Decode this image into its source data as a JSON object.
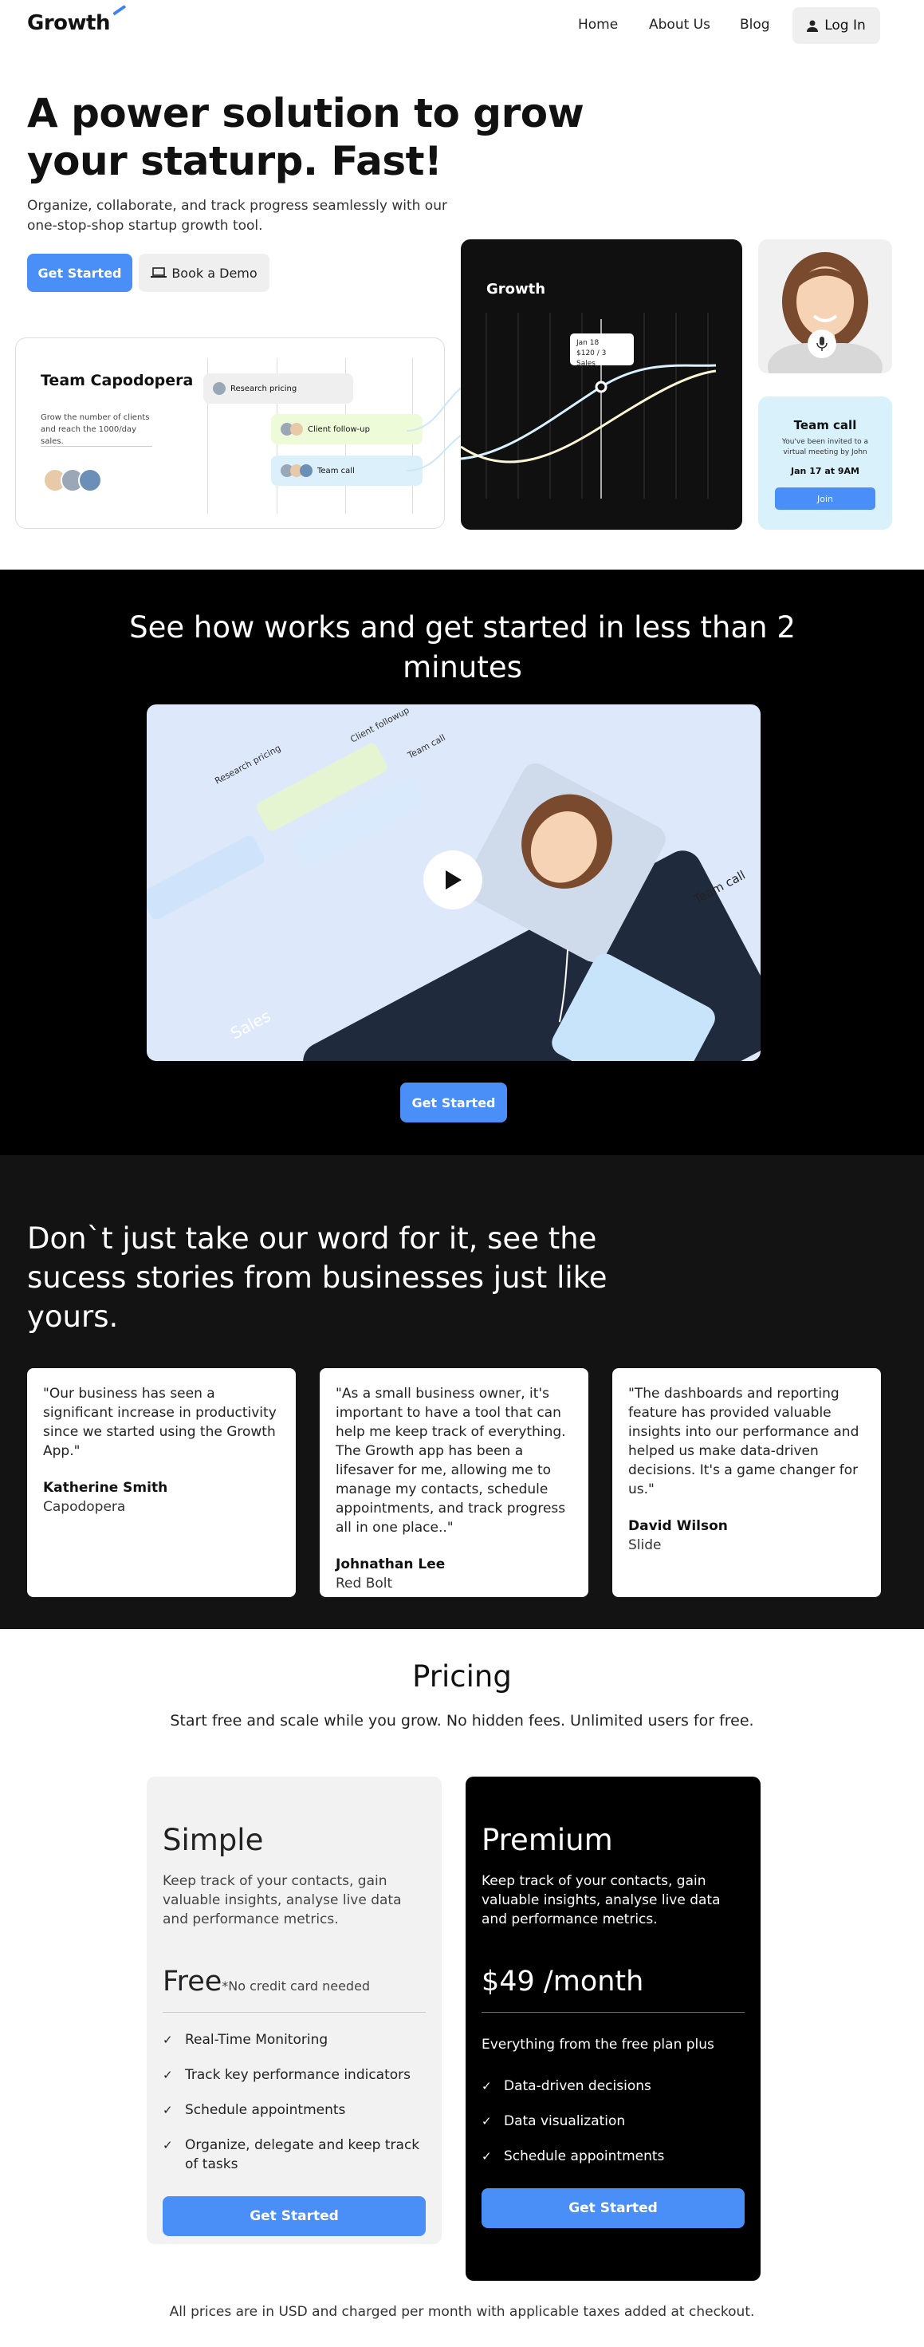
{
  "nav": {
    "logo": "Growth",
    "links": [
      "Home",
      "About Us",
      "Blog"
    ],
    "login": "Log In"
  },
  "hero": {
    "title": "A power solution to grow your staturp. Fast!",
    "subtitle": "Organize, collaborate, and track progress seamlessly with our one-stop-shop startup growth tool.",
    "cta_primary": "Get Started",
    "cta_secondary": "Book a Demo"
  },
  "team_card": {
    "title": "Team Capodopera",
    "description": "Grow the number of clients and reach the 1000/day sales.",
    "pills": [
      "Research pricing",
      "Client follow-up",
      "Team call"
    ]
  },
  "growth_card": {
    "title": "Growth",
    "tooltip_date": "Jan 18",
    "tooltip_value": "$120 / 3 Sales"
  },
  "call_card": {
    "title": "Team call",
    "description": "You've been invited to a virtual meeting by John",
    "date": "Jan 17 at 9AM",
    "join": "Join"
  },
  "video_section": {
    "title": "See how works and get started in less than 2 minutes",
    "preview_labels": {
      "research": "Research pricing",
      "followup": "Client followup",
      "teamcall": "Team call",
      "sales": "Sales",
      "call_title": "Team call"
    },
    "cta": "Get Started"
  },
  "testimonials": {
    "title": "Don`t just take our word for it, see the sucess stories from businesses just like yours.",
    "items": [
      {
        "quote": "\"Our business has seen a significant increase in productivity since we started using the Growth App.\"",
        "name": "Katherine Smith",
        "company": "Capodopera"
      },
      {
        "quote": "\"As a small business owner, it's important to have a tool that can help me keep track of everything. The Growth app has been a lifesaver for me, allowing me to manage my contacts, schedule appointments, and track progress all in one place..\"",
        "name": "Johnathan Lee",
        "company": "Red Bolt"
      },
      {
        "quote": "\"The dashboards and reporting feature has provided valuable insights into our performance and helped us make data-driven decisions. It's a game changer for us.\"",
        "name": "David Wilson",
        "company": "Slide"
      }
    ]
  },
  "pricing": {
    "title": "Pricing",
    "subtitle": "Start free and scale while you grow. No hidden fees. Unlimited users for free.",
    "plans": [
      {
        "name": "Simple",
        "description": "Keep track of your contacts, gain valuable insights, analyse live data and performance metrics.",
        "price": "Free",
        "price_note": "*No credit card needed",
        "features": [
          "Real-Time Monitoring",
          "Track key performance indicators",
          "Schedule appointments",
          "Organize, delegate and keep track of tasks"
        ],
        "cta": "Get Started"
      },
      {
        "name": "Premium",
        "description": "Keep track of your contacts, gain valuable insights, analyse live data and performance metrics.",
        "price": "$49 /month",
        "features_intro": "Everything from the free plan plus",
        "features": [
          "Data-driven decisions",
          "Data visualization",
          "Schedule appointments"
        ],
        "cta": "Get Started"
      }
    ],
    "footnote": "All prices are in USD and charged per month with applicable taxes added at checkout."
  },
  "colors": {
    "accent": "#4a8ff7",
    "dark": "#101010",
    "light_blue": "#d8f1fb"
  }
}
